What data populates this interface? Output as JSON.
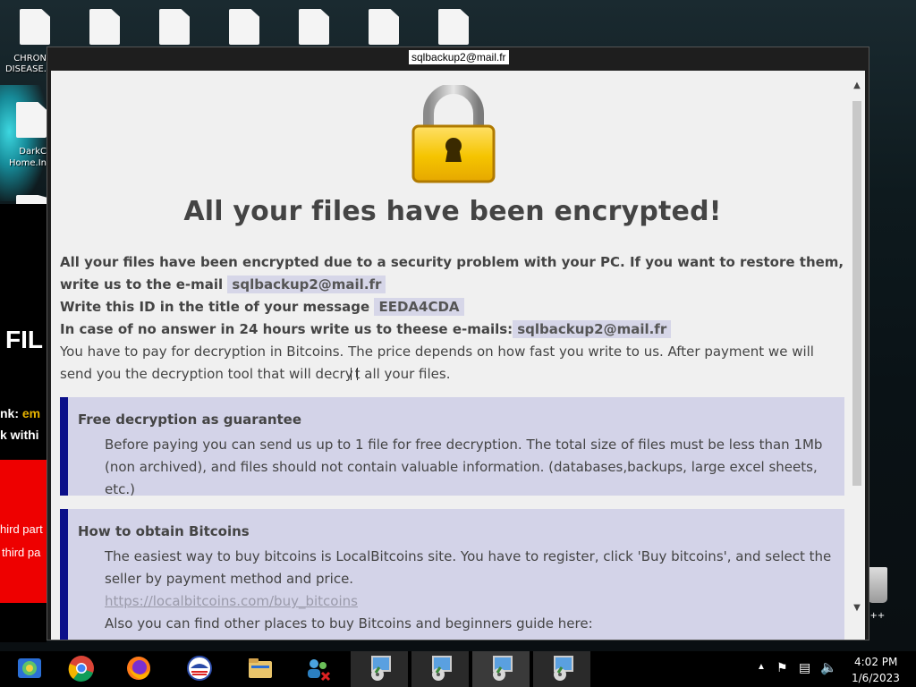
{
  "window": {
    "title": "sqlbackup2@mail.fr"
  },
  "desktop": {
    "labels": [
      "CHRON",
      "DISEASE.",
      "DarkC",
      "Home.In"
    ],
    "right_label": "n C++"
  },
  "background_app": {
    "heading": "FIL",
    "line1_a": "nk: ",
    "line1_b": "em",
    "line2": "k withi",
    "line3": "hird part",
    "line4": "third pa"
  },
  "ransom": {
    "headline": "All your files have been encrypted!",
    "p1_a": "All your files have been encrypted due to a security problem with your PC. If you want to restore them, write us to the e-mail",
    "email": "sqlbackup2@mail.fr",
    "p2": "Write this ID in the title of your message",
    "id": "EEDA4CDA",
    "p3": "In case of no answer in 24 hours write us to theese e-mails:",
    "email2": "sqlbackup2@mail.fr",
    "p4_a": "You have to pay for decryption in Bitcoins. The price depends on how fast you write to us. After payment we will send you the decryption tool that will decry",
    "p4_b": "t all your files.",
    "box1": {
      "title": "Free decryption as guarantee",
      "body": "Before paying you can send us up to 1 file for free decryption. The total size of files must be less than 1Mb (non archived), and files should not contain valuable information. (databases,backups, large excel sheets, etc.)"
    },
    "box2": {
      "title": "How to obtain Bitcoins",
      "body1": "The easiest way to buy bitcoins is LocalBitcoins site. You have to register, click 'Buy bitcoins', and select the seller by payment method and price.",
      "link": "https://localbitcoins.com/buy_bitcoins",
      "body2": "Also you can find other places to buy Bitcoins and beginners guide here:"
    }
  },
  "taskbar": {
    "time": "4:02 PM",
    "date": "1/6/2023"
  }
}
